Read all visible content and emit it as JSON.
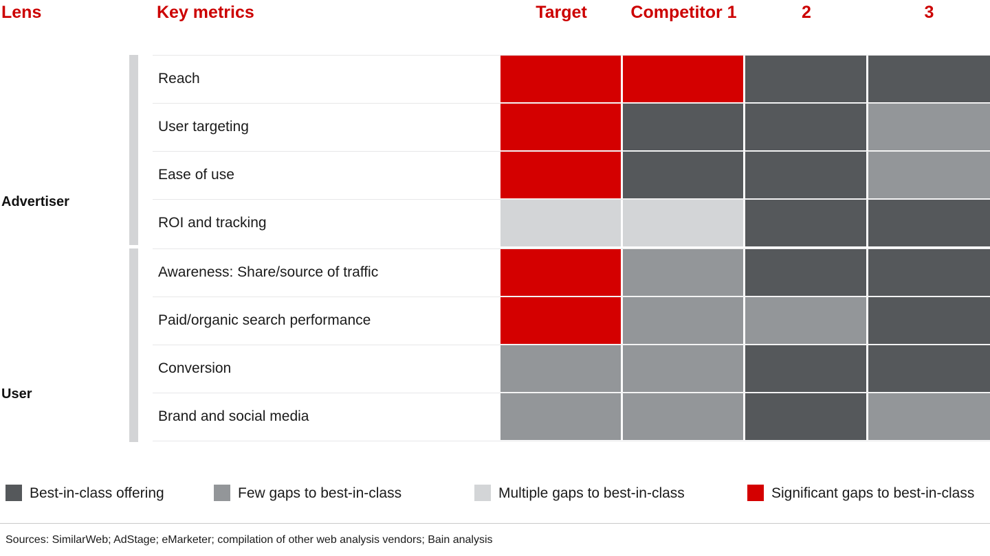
{
  "header": {
    "lens_label": "Lens",
    "metrics_label": "Key metrics",
    "columns": [
      "Target",
      "Competitor 1",
      "2",
      "3"
    ]
  },
  "sections": [
    {
      "label": "Advertiser"
    },
    {
      "label": "User"
    }
  ],
  "rows": [
    {
      "section": "Advertiser",
      "metric": "Reach"
    },
    {
      "section": "Advertiser",
      "metric": "User targeting"
    },
    {
      "section": "Advertiser",
      "metric": "Ease of use"
    },
    {
      "section": "Advertiser",
      "metric": "ROI and tracking"
    },
    {
      "section": "User",
      "metric": "Awareness: Share/source of traffic"
    },
    {
      "section": "User",
      "metric": "Paid/organic search performance"
    },
    {
      "section": "User",
      "metric": "Conversion"
    },
    {
      "section": "User",
      "metric": "Brand and social media"
    }
  ],
  "legend": [
    {
      "label": "Best-in-class offering",
      "color": "#55585b"
    },
    {
      "label": "Few gaps to best-in-class",
      "color": "#939699"
    },
    {
      "label": "Multiple gaps to best-in-class",
      "color": "#d3d5d7"
    },
    {
      "label": "Significant gaps to best-in-class",
      "color": "#d40000"
    }
  ],
  "footer": {
    "sources": "Sources: SimilarWeb; AdStage; eMarketer; compilation of other web analysis vendors; Bain analysis"
  },
  "colors": {
    "accent_red": "#cc0000",
    "cell_red": "#d40000",
    "cell_dark": "#55585b",
    "cell_mid": "#939699",
    "cell_light": "#d3d5d7",
    "section_bar": "#d3d4d6",
    "row_separator": "#e7e7e8"
  },
  "chart_data": {
    "type": "heatmap",
    "title": "",
    "categories": [
      "Target",
      "Competitor 1",
      "2",
      "3"
    ],
    "row_labels": [
      "Reach",
      "User targeting",
      "Ease of use",
      "ROI and tracking",
      "Awareness: Share/source of traffic",
      "Paid/organic search performance",
      "Conversion",
      "Brand and social media"
    ],
    "row_groups": [
      "Advertiser",
      "Advertiser",
      "Advertiser",
      "Advertiser",
      "User",
      "User",
      "User",
      "User"
    ],
    "scale": [
      {
        "level": "best-in-class",
        "label": "Best-in-class offering",
        "color": "#55585b"
      },
      {
        "level": "few-gaps",
        "label": "Few gaps to best-in-class",
        "color": "#939699"
      },
      {
        "level": "multiple-gaps",
        "label": "Multiple gaps to best-in-class",
        "color": "#d3d5d7"
      },
      {
        "level": "significant-gaps",
        "label": "Significant gaps to best-in-class",
        "color": "#d40000"
      }
    ],
    "values": [
      [
        "significant-gaps",
        "significant-gaps",
        "best-in-class",
        "best-in-class"
      ],
      [
        "significant-gaps",
        "best-in-class",
        "best-in-class",
        "few-gaps"
      ],
      [
        "significant-gaps",
        "best-in-class",
        "best-in-class",
        "few-gaps"
      ],
      [
        "multiple-gaps",
        "multiple-gaps",
        "best-in-class",
        "best-in-class"
      ],
      [
        "significant-gaps",
        "few-gaps",
        "best-in-class",
        "best-in-class"
      ],
      [
        "significant-gaps",
        "few-gaps",
        "few-gaps",
        "best-in-class"
      ],
      [
        "few-gaps",
        "few-gaps",
        "best-in-class",
        "best-in-class"
      ],
      [
        "few-gaps",
        "few-gaps",
        "best-in-class",
        "few-gaps"
      ]
    ],
    "xlabel": "",
    "ylabel": "",
    "legend_position": "bottom"
  }
}
